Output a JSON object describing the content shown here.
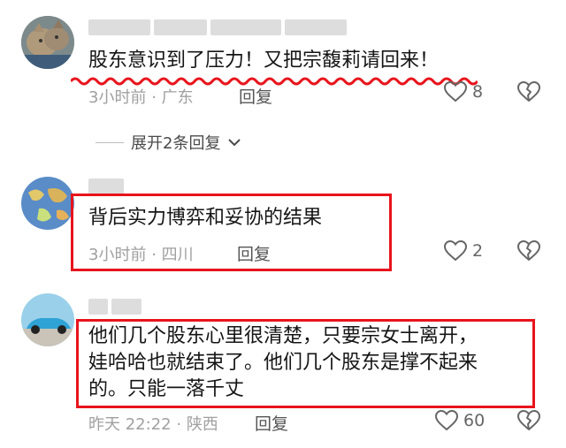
{
  "comments": [
    {
      "text": "股东意识到了压力！又把宗馥莉请回来！",
      "time": "3小时前",
      "location": "广东",
      "reply_label": "回复",
      "likes": "8",
      "expand_label": "展开2条回复"
    },
    {
      "text": "背后实力博弈和妥协的结果",
      "time": "3小时前",
      "location": "四川",
      "reply_label": "回复",
      "likes": "2"
    },
    {
      "text_lines": [
        "他们几个股东心里很清楚，只要宗女士离开，",
        "娃哈哈也就结束了。他们几个股东是撑不起来",
        "的。只能一落千丈"
      ],
      "time": "昨天 22:22",
      "location": "陕西",
      "reply_label": "回复",
      "likes": "60"
    }
  ],
  "meta_separator": "·",
  "colors": {
    "highlight": "#e8141c",
    "meta_text": "#a0a0a0"
  },
  "icons": [
    "heart-outline-icon",
    "broken-heart-icon",
    "chevron-down-icon"
  ]
}
